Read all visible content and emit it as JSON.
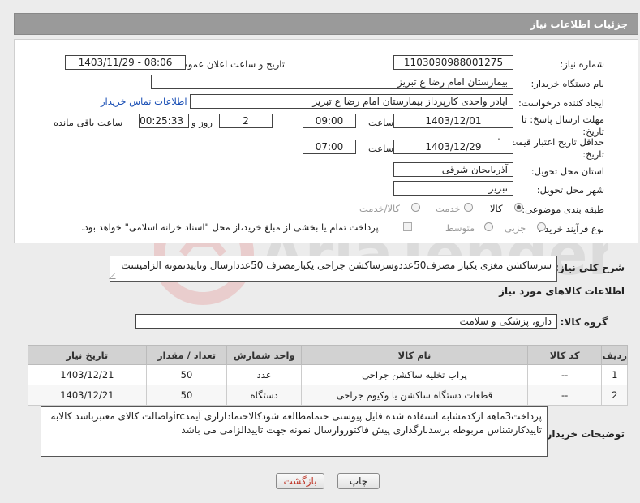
{
  "header": {
    "title": "جزئیات اطلاعات نیاز"
  },
  "fields": {
    "need_number_label": "شماره نیاز:",
    "need_number": "1103090988001275",
    "announce_label": "تاریخ و ساعت اعلان عمومی:",
    "announce_value": "1403/11/29 - 08:06",
    "buyer_org_label": "نام دستگاه خریدار:",
    "buyer_org": "بیمارستان امام رضا  ع  تبریز",
    "requester_label": "ایجاد کننده درخواست:",
    "requester": "ایادر واحدی کارپرداز بیمارستان امام رضا  ع  تبریز",
    "contact_link": "اطلاعات تماس خریدار",
    "deadline_label": "مهلت ارسال پاسخ: تا تاریخ:",
    "deadline_date": "1403/12/01",
    "time_label": "ساعت",
    "deadline_time": "09:00",
    "days_value": "2",
    "days_and_label": "روز و",
    "remaining_time": "00:25:33",
    "remaining_label": "ساعت باقی مانده",
    "validity_label": "حداقل تاریخ اعتبار قیمت: تا تاریخ:",
    "validity_date": "1403/12/29",
    "validity_time": "07:00",
    "province_label": "استان محل تحویل:",
    "province": "آذربایجان شرقی",
    "city_label": "شهر محل تحویل:",
    "city": "تبریز",
    "category_label": "طبقه بندی موضوعی:",
    "category_options": [
      "کالا",
      "خدمت",
      "کالا/خدمت"
    ],
    "process_label": "نوع فرآیند خرید :",
    "process_options": [
      "جزیی",
      "متوسط"
    ],
    "payment_note": "پرداخت تمام یا بخشی از مبلغ خرید،از محل \"اسناد خزانه اسلامی\" خواهد بود."
  },
  "summary": {
    "label": "شرح کلی نیاز:",
    "text": "سرساکشن مغزی یکبار مصرف50عددوسرساکشن جراحی یکبارمصرف 50عددارسال وتاییدنمونه الزامیست"
  },
  "goods": {
    "section_title": "اطلاعات کالاهای مورد نیاز",
    "group_label": "گروه کالا:",
    "group_value": "دارو، پزشکی و سلامت",
    "columns": [
      "ردیف",
      "کد کالا",
      "نام کالا",
      "واحد شمارش",
      "تعداد / مقدار",
      "تاریخ نیاز"
    ],
    "rows": [
      [
        "1",
        "--",
        "پراب تخلیه ساکشن جراحی",
        "عدد",
        "50",
        "1403/12/21"
      ],
      [
        "2",
        "--",
        "قطعات دستگاه ساکشن یا وکیوم جراحی",
        "دستگاه",
        "50",
        "1403/12/21"
      ]
    ]
  },
  "buyer_notes": {
    "label": "توضیحات خریدار:",
    "text": "پرداخت3ماهه ازکدمشابه استفاده شده فایل پیوستی حتمامطالعه شودکالاحتماداراری آیمدircواصالت کالای معتبرباشد کالابه تاییدکارشناس مربوطه برسدبارگذاری پیش فاکتوروارسال نمونه جهت تاییدالزامی می باشد"
  },
  "buttons": {
    "print": "چاپ",
    "back": "بازگشت"
  },
  "colors": {
    "header_bg": "#9a9a9a",
    "link": "#1a4fb5",
    "back_text": "#c0392b"
  }
}
